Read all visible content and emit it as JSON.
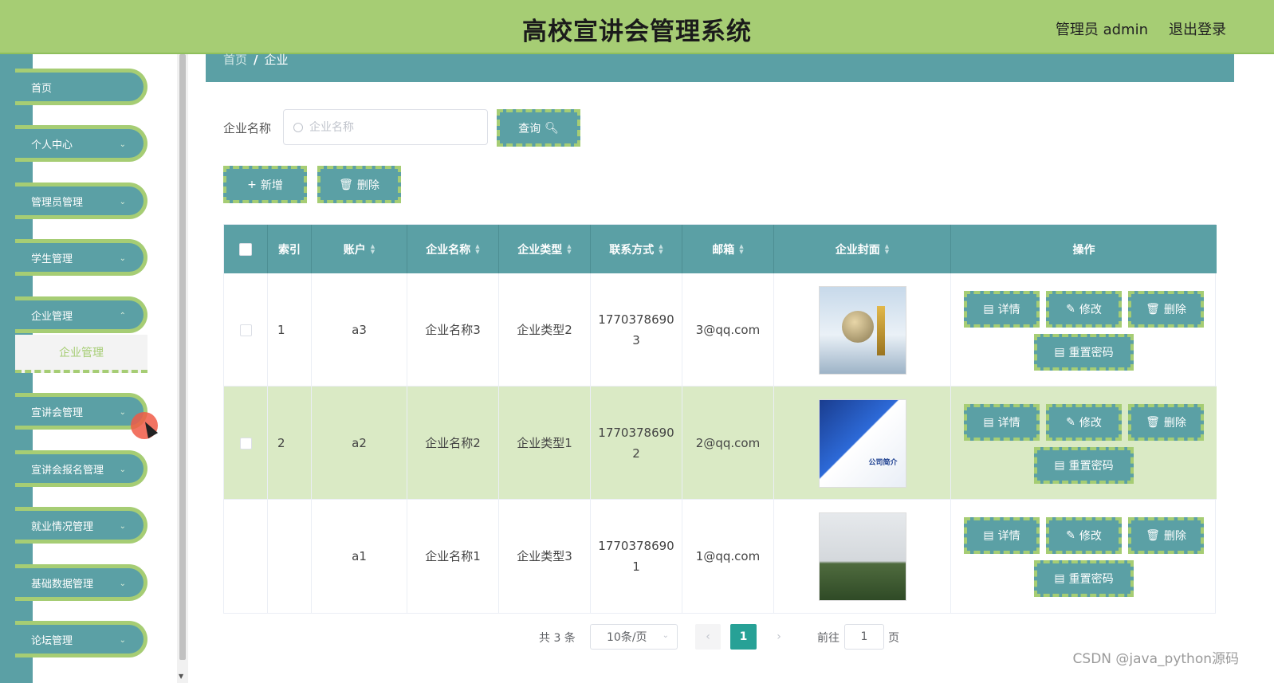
{
  "header": {
    "title": "高校宣讲会管理系统",
    "user": "管理员 admin",
    "logout": "退出登录"
  },
  "sidebar": {
    "items": [
      {
        "label": "首页",
        "has_children": false
      },
      {
        "label": "个人中心",
        "has_children": true
      },
      {
        "label": "管理员管理",
        "has_children": true
      },
      {
        "label": "学生管理",
        "has_children": true
      },
      {
        "label": "企业管理",
        "has_children": true
      },
      {
        "label": "宣讲会管理",
        "has_children": true
      },
      {
        "label": "宣讲会报名管理",
        "has_children": true
      },
      {
        "label": "就业情况管理",
        "has_children": true
      },
      {
        "label": "基础数据管理",
        "has_children": true
      },
      {
        "label": "论坛管理",
        "has_children": true
      }
    ],
    "active_sub": "企业管理"
  },
  "breadcrumb": {
    "home": "首页",
    "sep": "/",
    "current": "企业"
  },
  "search": {
    "label": "企业名称",
    "placeholder": "企业名称",
    "value": "",
    "button": "查询"
  },
  "toolbar": {
    "add": "新增",
    "delete": "删除"
  },
  "table": {
    "columns": [
      "索引",
      "账户",
      "企业名称",
      "企业类型",
      "联系方式",
      "邮箱",
      "企业封面",
      "操作"
    ],
    "rows": [
      {
        "index": "1",
        "account": "a3",
        "name": "企业名称3",
        "type": "企业类型2",
        "phone": "1770378690\n3",
        "email": "3@qq.com",
        "cover": "cover1"
      },
      {
        "index": "2",
        "account": "a2",
        "name": "企业名称2",
        "type": "企业类型1",
        "phone": "1770378690\n2",
        "email": "2@qq.com",
        "cover": "cover2"
      },
      {
        "index": "",
        "account": "a1",
        "name": "企业名称1",
        "type": "企业类型3",
        "phone": "1770378690\n1",
        "email": "1@qq.com",
        "cover": "cover3"
      }
    ],
    "actions": {
      "detail": "详情",
      "edit": "修改",
      "delete": "删除",
      "reset": "重置密码"
    }
  },
  "pagination": {
    "total": "共 3 条",
    "page_size": "10条/页",
    "current": "1",
    "goto_label": "前往",
    "goto_value": "1",
    "page_suffix": "页"
  },
  "watermark": "CSDN @java_python源码",
  "colors": {
    "accent_green": "#a6cd74",
    "teal": "#5ba0a5",
    "alt_row": "#daeac5",
    "active_page": "#27a196"
  }
}
